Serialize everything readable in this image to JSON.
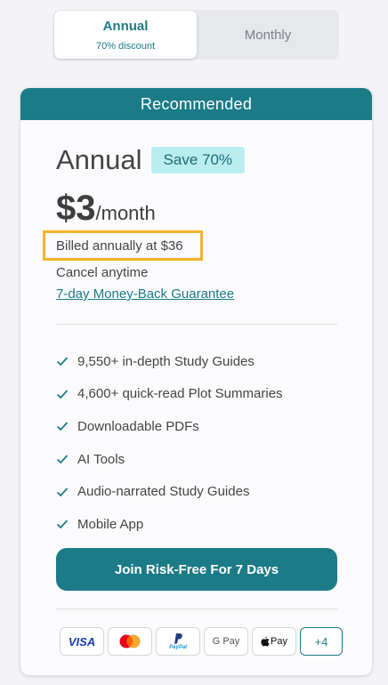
{
  "toggle": {
    "annual_label": "Annual",
    "annual_sub": "70% discount",
    "monthly_label": "Monthly"
  },
  "card": {
    "banner": "Recommended",
    "plan_name": "Annual",
    "save_badge": "Save 70%",
    "price_amount": "$3",
    "price_period": "/month",
    "billed": "Billed annually at $36",
    "cancel": "Cancel anytime",
    "guarantee": "7-day Money-Back Guarantee",
    "features": [
      "9,550+ in-depth Study Guides",
      "4,600+ quick-read Plot Summaries",
      "Downloadable PDFs",
      "AI Tools",
      "Audio-narrated Study Guides",
      "Mobile App"
    ],
    "cta": "Join Risk-Free For 7 Days"
  },
  "payments": {
    "visa": "VISA",
    "mastercard": "mastercard-icon",
    "paypal": "PayPal",
    "gpay": "G Pay",
    "applepay": "Pay",
    "more": "+4"
  },
  "colors": {
    "accent": "#1b7b87",
    "badge_bg": "#b9eef0",
    "highlight": "#f5b328"
  }
}
